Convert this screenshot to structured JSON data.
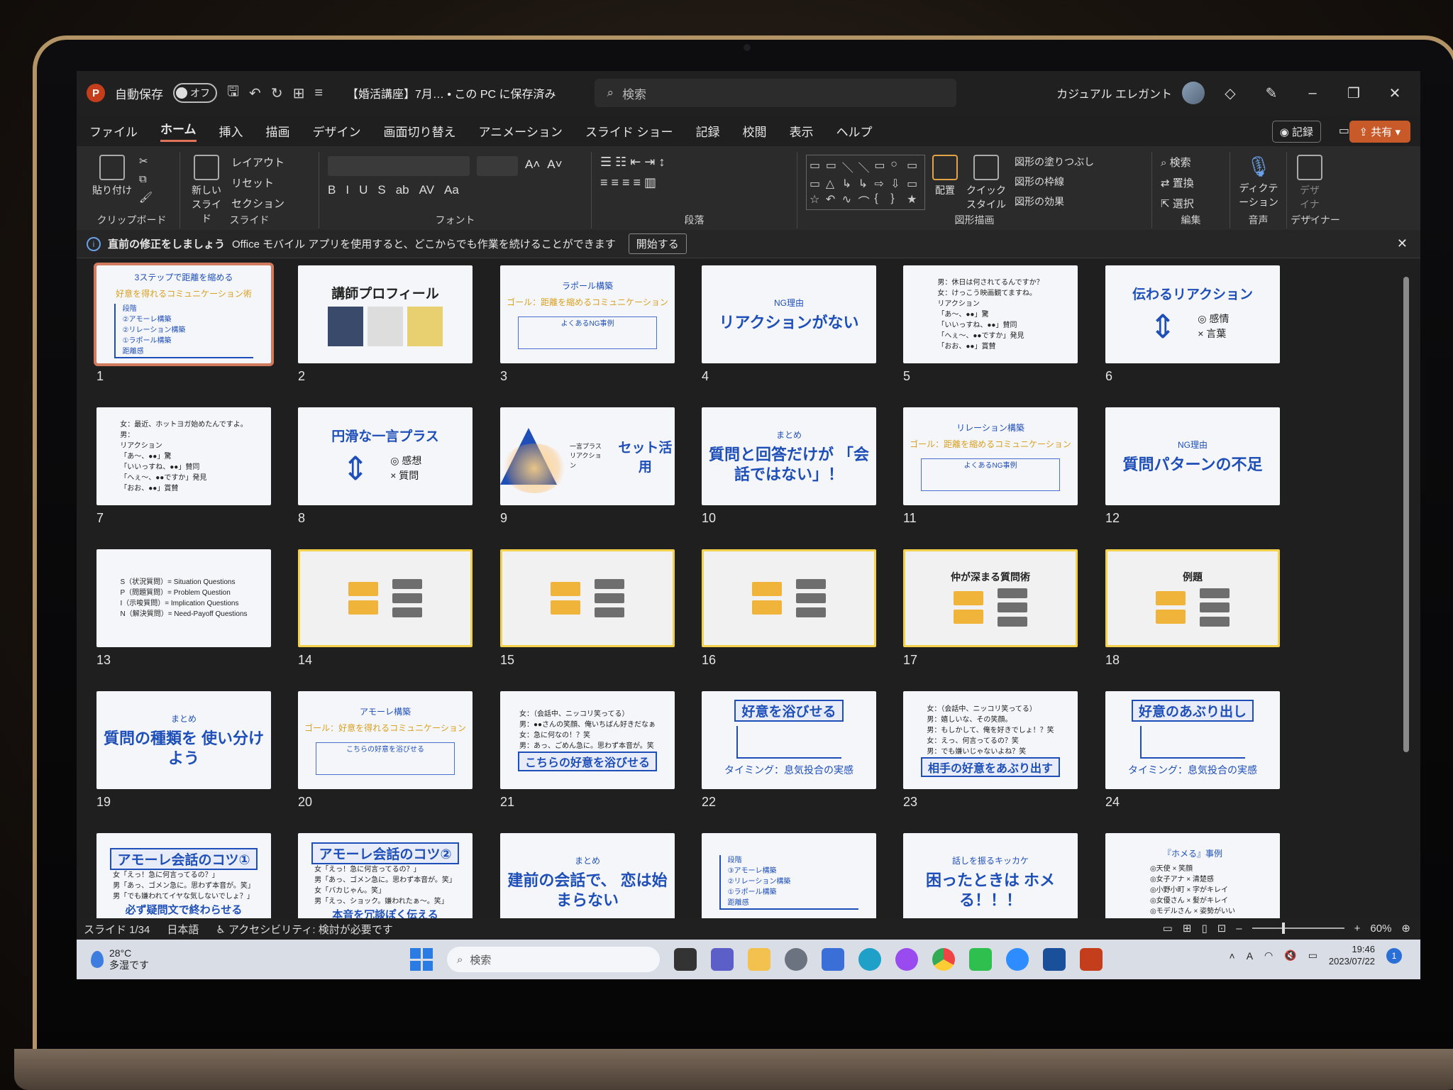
{
  "app": {
    "autosave_label": "自動保存",
    "autosave_state": "オフ",
    "doc_title": "【婚活講座】7月… • この PC に保存済み",
    "search_placeholder": "検索",
    "user_name": "カジュアル エレガント"
  },
  "menu": [
    "ファイル",
    "ホーム",
    "挿入",
    "描画",
    "デザイン",
    "画面切り替え",
    "アニメーション",
    "スライド ショー",
    "記録",
    "校閲",
    "表示",
    "ヘルプ"
  ],
  "menu_active": "ホーム",
  "menu_right": {
    "record": "記録",
    "share": "共有"
  },
  "ribbon": {
    "clipboard": {
      "paste": "貼り付け",
      "label": "クリップボード"
    },
    "slides": {
      "new_slide": "新しい スライド",
      "layout": "レイアウト",
      "reset": "リセット",
      "section": "セクション",
      "label": "スライド"
    },
    "font": {
      "label": "フォント",
      "format": [
        "B",
        "I",
        "U",
        "S",
        "ab",
        "AV",
        "Aa"
      ]
    },
    "paragraph": {
      "label": "段落"
    },
    "drawing": {
      "arrange": "配置",
      "quick_style": "クイック スタイル",
      "fill": "図形の塗りつぶし",
      "outline": "図形の枠線",
      "effects": "図形の効果",
      "label": "図形描画"
    },
    "editing": {
      "find": "検索",
      "replace": "置換",
      "select": "選択",
      "label": "編集"
    },
    "voice": {
      "dictate": "ディクテーション",
      "label": "音声"
    },
    "designer": {
      "button": "デザイナー",
      "label": "デザイナー"
    }
  },
  "notice": {
    "bold": "直前の修正をしましょう",
    "text": "Office モバイル アプリを使用すると、どこからでも作業を続けることができます",
    "button": "開始する"
  },
  "slides": [
    {
      "n": "1",
      "kind": "chart",
      "title": "3ステップで距離を縮める",
      "sub": "好意を得れるコミュニケーション術",
      "labels": [
        "段階",
        "②アモーレ構築",
        "②リレーション構築",
        "①ラポール構築",
        "距離感"
      ]
    },
    {
      "n": "2",
      "kind": "profile",
      "title": "講師プロフィール"
    },
    {
      "n": "3",
      "kind": "panel",
      "title": "ラポール構築",
      "sub": "ゴール：距離を縮めるコミュニケーション",
      "inner": "よくあるNG事例"
    },
    {
      "n": "4",
      "kind": "title",
      "sub": "NG理由",
      "title": "リアクションがない"
    },
    {
      "n": "5",
      "kind": "lines",
      "lines": [
        "男：休日は何されてるんですか？",
        "女：けっこう映画観てますね。",
        "リアクション",
        "「あ〜、●●」驚",
        "「いいっすね、●●」賛同",
        "「へぇ〜、●●ですか」発見",
        "「おお、●●」賞賛"
      ]
    },
    {
      "n": "6",
      "kind": "arrows",
      "title": "伝わるリアクション",
      "a": "◎ 感情",
      "b": "× 言葉"
    },
    {
      "n": "7",
      "kind": "lines",
      "lines": [
        "女：最近、ホットヨガ始めたんですよ。",
        "男：",
        "リアクション",
        "「あ〜、●●」驚",
        "「いいっすね、●●」賛同",
        "「へぇ〜、●●ですか」発見",
        "「おお、●●」賞賛"
      ]
    },
    {
      "n": "8",
      "kind": "arrows",
      "title": "円滑な一言プラス",
      "a": "◎ 感想",
      "b": "× 質問"
    },
    {
      "n": "9",
      "kind": "triangle",
      "title": "セット活用",
      "a": "一言プラス",
      "b": "リアクション"
    },
    {
      "n": "10",
      "kind": "title",
      "sub": "まとめ",
      "title": "質問と回答だけが 「会話ではない」！"
    },
    {
      "n": "11",
      "kind": "panel",
      "title": "リレーション構築",
      "sub": "ゴール：距離を縮めるコミュニケーション",
      "inner": "よくあるNG事例"
    },
    {
      "n": "12",
      "kind": "title",
      "sub": "NG理由",
      "title": "質問パターンの不足"
    },
    {
      "n": "13",
      "kind": "lines",
      "lines": [
        "S（状況質問）= Situation Questions",
        "P（問題質問）= Problem Question",
        "I（示唆質問）= Implication Questions",
        "N（解決質問）= Need-Payoff Questions"
      ]
    },
    {
      "n": "14",
      "kind": "tree"
    },
    {
      "n": "15",
      "kind": "tree"
    },
    {
      "n": "16",
      "kind": "tree"
    },
    {
      "n": "17",
      "kind": "tree",
      "title": "仲が深まる質問術"
    },
    {
      "n": "18",
      "kind": "tree",
      "title": "例題"
    },
    {
      "n": "19",
      "kind": "title",
      "sub": "まとめ",
      "title": "質問の種類を 使い分けよう"
    },
    {
      "n": "20",
      "kind": "panel",
      "title": "アモーレ構築",
      "sub": "ゴール：好意を得れるコミュニケーション",
      "inner": "こちらの好意を浴びせる"
    },
    {
      "n": "21",
      "kind": "boxed",
      "lines": [
        "女：（会話中、ニッコリ笑ってる）",
        "男：●●さんの笑顔、俺いちばん好きだなぁ",
        "女：急に何なの！？笑",
        "男：あっ、ごめん急に。思わず本音が。笑"
      ],
      "title": "こちらの好意を浴びせる"
    },
    {
      "n": "22",
      "kind": "chart2",
      "title": "好意を浴びせる",
      "foot": "タイミング：息気投合の実感"
    },
    {
      "n": "23",
      "kind": "boxed",
      "lines": [
        "女：（会話中、ニッコリ笑ってる）",
        "男：嬉しいな、その笑顔。",
        "男：もしかして、俺を好きでしょ！？笑",
        "女：えっ、何言ってるの？笑",
        "男：でも嫌いじゃないよね？笑"
      ],
      "title": "相手の好意をあぶり出す"
    },
    {
      "n": "24",
      "kind": "chart2",
      "title": "好意のあぶり出し",
      "foot": "タイミング：息気投合の実感"
    },
    {
      "n": "25",
      "kind": "boxed-top",
      "title": "アモーレ会話のコツ①",
      "lines": [
        "女「えっ！急に何言ってるの？」",
        "男「あっ、ゴメン急に。思わず本音が。笑」",
        "男「でも嫌われてイヤな気しないでしょ？」"
      ],
      "foot": "必ず疑問文で終わらせる"
    },
    {
      "n": "26",
      "kind": "boxed-top",
      "title": "アモーレ会話のコツ②",
      "lines": [
        "女「えっ！急に何言ってるの？」",
        "男「あっ、ゴメン急に。思わず本音が。笑」",
        "女「バカじゃん。笑」",
        "男「えっ、ショック。嫌われたぁ〜。笑」"
      ],
      "foot": "本音を冗談ぽく伝える"
    },
    {
      "n": "27",
      "kind": "title",
      "sub": "まとめ",
      "title": "建前の会話で、 恋は始まらない"
    },
    {
      "n": "28",
      "kind": "chart3",
      "labels": [
        "段階",
        "③アモーレ構築",
        "②リレーション構築",
        "①ラポール構築",
        "距離感"
      ]
    },
    {
      "n": "29",
      "kind": "title",
      "sub": "話しを振るキッカケ",
      "title": "困ったときは ホメる！！！"
    },
    {
      "n": "30",
      "kind": "lines-title",
      "title": "『ホメる』事例",
      "lines": [
        "◎天使 × 笑顔",
        "◎女子アナ × 清楚感",
        "◎小野小町 × 字がキレイ",
        "◎女優さん × 髪がキレイ",
        "◎モデルさん × 姿勢がいい"
      ]
    }
  ],
  "status": {
    "slide_pos": "スライド 1/34",
    "language": "日本語",
    "accessibility": "アクセシビリティ: 検討が必要です",
    "zoom": "60%"
  },
  "taskbar": {
    "temp": "28°C",
    "weather": "多湿です",
    "search": "検索",
    "time": "19:46",
    "date": "2023/07/22",
    "notif": "1"
  }
}
